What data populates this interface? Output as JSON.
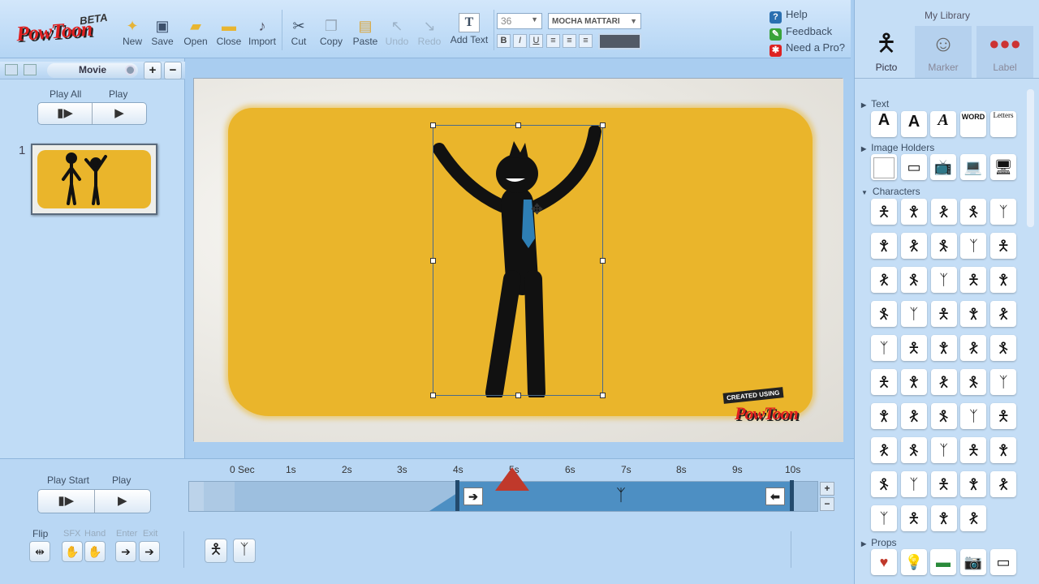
{
  "app": {
    "name": "PowToon",
    "badge": "BETA"
  },
  "toolbar": {
    "buttons": [
      {
        "label": "New",
        "icon": "new-icon"
      },
      {
        "label": "Save",
        "icon": "save-icon"
      },
      {
        "label": "Open",
        "icon": "open-folder-icon"
      },
      {
        "label": "Close",
        "icon": "close-folder-icon"
      },
      {
        "label": "Import",
        "icon": "import-icon"
      },
      {
        "label": "Cut",
        "icon": "scissors-icon"
      },
      {
        "label": "Copy",
        "icon": "copy-icon"
      },
      {
        "label": "Paste",
        "icon": "paste-icon"
      },
      {
        "label": "Undo",
        "icon": "undo-icon",
        "disabled": true
      },
      {
        "label": "Redo",
        "icon": "redo-icon",
        "disabled": true
      },
      {
        "label": "Add Text",
        "icon": "text-icon"
      }
    ],
    "font_size": "36",
    "font_name": "MOCHA MATTARI",
    "format": [
      "B",
      "I",
      "U"
    ]
  },
  "help": {
    "help": "Help",
    "feedback": "Feedback",
    "pro": "Need a Pro?"
  },
  "left": {
    "tab": "Movie",
    "play_all": "Play All",
    "play": "Play",
    "slide_number": "1"
  },
  "stage": {
    "watermark_top": "CREATED USING",
    "watermark_brand": "PowToon"
  },
  "timeline": {
    "ticks": [
      "0 Sec",
      "1s",
      "2s",
      "3s",
      "4s",
      "5s",
      "6s",
      "7s",
      "8s",
      "9s",
      "10s"
    ],
    "play_start": "Play Start",
    "play": "Play",
    "flip": "Flip",
    "sfx": "SFX",
    "hand": "Hand",
    "enter": "Enter",
    "exit": "Exit"
  },
  "library": {
    "title": "My Library",
    "tabs": [
      "Picto",
      "Marker",
      "Label"
    ],
    "categories": {
      "text": "Text",
      "image_holders": "Image Holders",
      "characters": "Characters",
      "props": "Props"
    },
    "text_items": [
      "A",
      "A",
      "A",
      "WORD",
      "Letters"
    ]
  },
  "colors": {
    "accent_red": "#c0392b",
    "stage_yellow": "#eab52b",
    "timeline_blue": "#4d8fc3"
  }
}
